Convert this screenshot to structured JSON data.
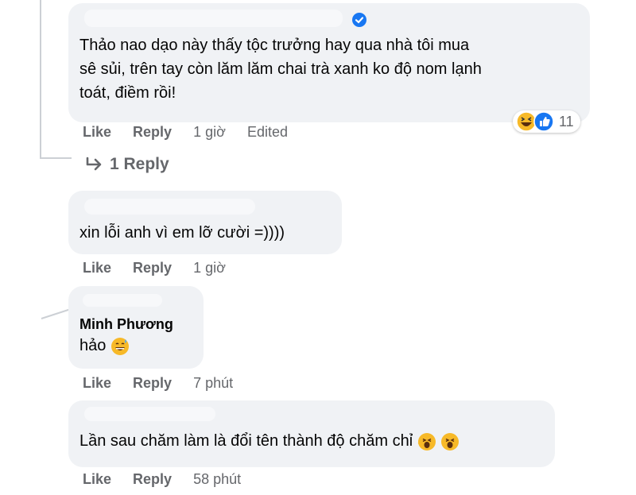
{
  "comments": [
    {
      "text": "Thảo nao dạo này thấy tộc trưởng hay qua nhà tôi mua sê sủi, trên tay còn lăm lăm chai trà xanh ko độ nom lạnh toát, điềm rồi!",
      "line1": "Thảo nao dạo này thấy tộc trưởng hay qua nhà tôi mua",
      "line2": "sê sủi, trên tay còn lăm lăm chai trà xanh ko độ nom lạnh",
      "line3": "toát, điềm rồi!",
      "like": "Like",
      "reply": "Reply",
      "time": "1 giờ",
      "edited": "Edited",
      "reaction_count": "11",
      "reactions": [
        "haha-icon",
        "like-icon"
      ],
      "replies_link": "1 Reply"
    },
    {
      "text": "xin lỗi anh vì em lỡ cười =))))",
      "like": "Like",
      "reply": "Reply",
      "time": "1 giờ"
    },
    {
      "author": "Minh Phương",
      "text": "hảo",
      "emoji": "grinning-sweat-emoji",
      "like": "Like",
      "reply": "Reply",
      "time": "7 phút"
    },
    {
      "text": "Lần sau chăm làm là đổi tên thành độ chăm chỉ",
      "emoji": "laughing-emoji",
      "like": "Like",
      "reply": "Reply",
      "time": "58 phút"
    }
  ],
  "colors": {
    "bubble": "#f0f2f5",
    "meta": "#65676b",
    "verified": "#1877f2",
    "like_blue": "#1877f2",
    "emoji_yellow": "#f7b928"
  }
}
